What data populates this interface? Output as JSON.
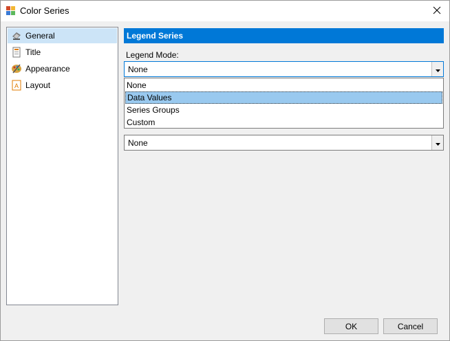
{
  "window": {
    "title": "Color Series",
    "icon": "chart-app-icon",
    "close_icon": "close-icon"
  },
  "sidebar": {
    "items": [
      {
        "label": "General",
        "icon": "general-icon",
        "selected": true
      },
      {
        "label": "Title",
        "icon": "title-icon",
        "selected": false
      },
      {
        "label": "Appearance",
        "icon": "appearance-icon",
        "selected": false
      },
      {
        "label": "Layout",
        "icon": "layout-icon",
        "selected": false
      }
    ]
  },
  "main": {
    "section_header": "Legend Series",
    "legend_mode_label": "Legend Mode:",
    "legend_mode_value": "None",
    "dropdown_options": [
      "None",
      "Data Values",
      "Series Groups",
      "Custom"
    ],
    "dropdown_hover_index": 1,
    "second_combo_value": "None"
  },
  "buttons": {
    "ok": "OK",
    "cancel": "Cancel"
  },
  "colors": {
    "accent": "#0078d7",
    "selection": "#cce4f7",
    "hover": "#99c9ef"
  }
}
